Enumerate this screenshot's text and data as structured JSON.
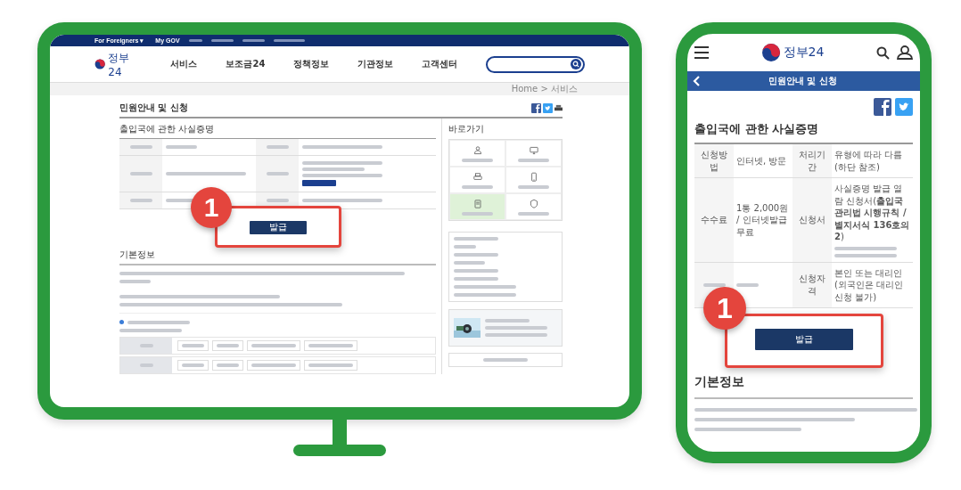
{
  "desktop": {
    "top_bar": {
      "language": "For Foreigners ▾",
      "account": "My GOV"
    },
    "logo": "정부24",
    "nav": [
      "서비스",
      "보조금24",
      "정책정보",
      "기관정보",
      "고객센터"
    ],
    "breadcrumb": "Home > 서비스",
    "page_title": "민원안내 및 신청",
    "service_title": "출입국에 관한 사실증명",
    "issue_button": "발급",
    "step_badge": "1",
    "section_title": "기본정보",
    "side_title": "바로가기",
    "quick_links": [
      {
        "selected": false
      },
      {
        "selected": false
      },
      {
        "selected": false
      },
      {
        "selected": false
      },
      {
        "selected": true
      },
      {
        "selected": false
      }
    ]
  },
  "mobile": {
    "logo": "정부24",
    "header_title": "민원안내 및 신청",
    "service_title": "출입국에 관한 사실증명",
    "table": [
      {
        "label": "신청방법",
        "value": "인터넷, 방문",
        "label_2": "처리기간",
        "value_2": "유형에 따라 다름(하단 참조)"
      },
      {
        "label": "수수료",
        "value": "1통 2,000원 / 인터넷발급 무료",
        "label_2": "신청서",
        "value_2": "사실증명 발급 열람 신청서(**출입국관리법 시행규칙 / 별지서식 136호의2**)"
      },
      {
        "label_2": "신청자격",
        "value_2": "본인 또는 대리인(외국인은 대리인 신청 불가)"
      }
    ],
    "issue_button": "발급",
    "step_badge": "1",
    "section_title": "기본정보"
  }
}
